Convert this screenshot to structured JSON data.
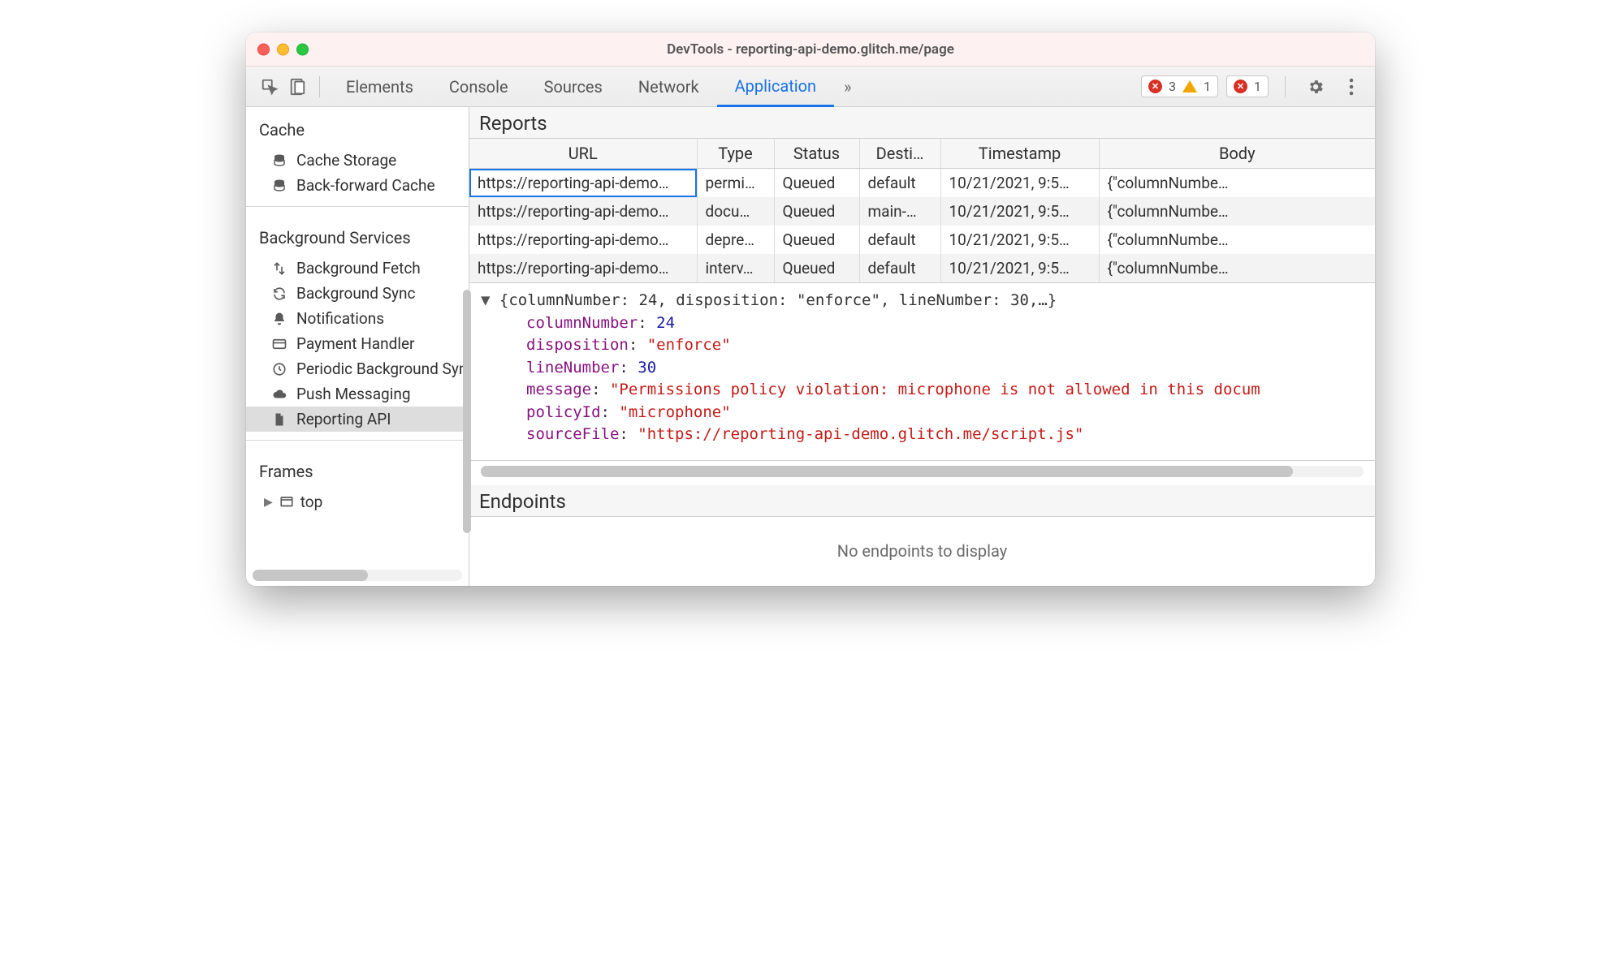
{
  "window": {
    "title": "DevTools - reporting-api-demo.glitch.me/page"
  },
  "toolbar": {
    "tabs": [
      {
        "label": "Elements"
      },
      {
        "label": "Console"
      },
      {
        "label": "Sources"
      },
      {
        "label": "Network"
      },
      {
        "label": "Application",
        "active": true
      }
    ],
    "more_chevron": "»",
    "badges": {
      "errors_count": "3",
      "warnings_count": "1",
      "close_group_count": "1"
    }
  },
  "sidebar": {
    "sections": [
      {
        "title": "Cache",
        "items": [
          {
            "icon": "database-icon",
            "label": "Cache Storage"
          },
          {
            "icon": "database-icon",
            "label": "Back-forward Cache"
          }
        ]
      },
      {
        "title": "Background Services",
        "items": [
          {
            "icon": "transfer-icon",
            "label": "Background Fetch"
          },
          {
            "icon": "sync-icon",
            "label": "Background Sync"
          },
          {
            "icon": "bell-icon",
            "label": "Notifications"
          },
          {
            "icon": "card-icon",
            "label": "Payment Handler"
          },
          {
            "icon": "clock-icon",
            "label": "Periodic Background Sync"
          },
          {
            "icon": "cloud-icon",
            "label": "Push Messaging"
          },
          {
            "icon": "file-icon",
            "label": "Reporting API",
            "selected": true
          }
        ]
      },
      {
        "title": "Frames",
        "items": [
          {
            "icon": "frame-icon",
            "label": "top",
            "expandable": true
          }
        ]
      }
    ]
  },
  "reports": {
    "title": "Reports",
    "columns": [
      "URL",
      "Type",
      "Status",
      "Desti…",
      "Timestamp",
      "Body"
    ],
    "rows": [
      {
        "url": "https://reporting-api-demo…",
        "type": "permi…",
        "status": "Queued",
        "dest": "default",
        "ts": "10/21/2021, 9:5…",
        "body": "{\"columnNumbe…",
        "selected": true
      },
      {
        "url": "https://reporting-api-demo…",
        "type": "docu…",
        "status": "Queued",
        "dest": "main-…",
        "ts": "10/21/2021, 9:5…",
        "body": "{\"columnNumbe…"
      },
      {
        "url": "https://reporting-api-demo…",
        "type": "depre…",
        "status": "Queued",
        "dest": "default",
        "ts": "10/21/2021, 9:5…",
        "body": "{\"columnNumbe…"
      },
      {
        "url": "https://reporting-api-demo…",
        "type": "interv…",
        "status": "Queued",
        "dest": "default",
        "ts": "10/21/2021, 9:5…",
        "body": "{\"columnNumbe…"
      }
    ]
  },
  "json_detail": {
    "summary": "{columnNumber: 24, disposition: \"enforce\", lineNumber: 30,…}",
    "props": [
      {
        "key": "columnNumber",
        "value": "24",
        "vtype": "num"
      },
      {
        "key": "disposition",
        "value": "\"enforce\"",
        "vtype": "str"
      },
      {
        "key": "lineNumber",
        "value": "30",
        "vtype": "num"
      },
      {
        "key": "message",
        "value": "\"Permissions policy violation: microphone is not allowed in this docum",
        "vtype": "str"
      },
      {
        "key": "policyId",
        "value": "\"microphone\"",
        "vtype": "str"
      },
      {
        "key": "sourceFile",
        "value": "\"https://reporting-api-demo.glitch.me/script.js\"",
        "vtype": "str"
      }
    ]
  },
  "endpoints": {
    "title": "Endpoints",
    "empty_message": "No endpoints to display"
  }
}
